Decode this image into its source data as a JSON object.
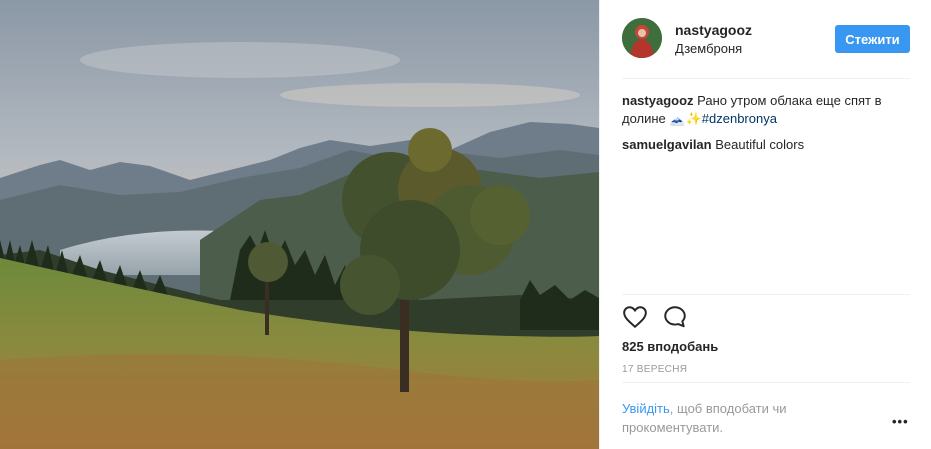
{
  "photo": {
    "description_icon": "landscape-photo"
  },
  "header": {
    "username": "nastyagooz",
    "location": "Дземброня",
    "follow_label": "Стежити"
  },
  "comments": [
    {
      "user": "nastyagooz",
      "text": "Рано утром облака еще спят в долине ",
      "emoji": "🗻✨",
      "hashtag": "#dzenbronya"
    },
    {
      "user": "samuelgavilan",
      "text": "Beautiful colors"
    }
  ],
  "actions": {
    "like_icon": "heart-icon",
    "comment_icon": "comment-icon"
  },
  "likes": "825 вподобань",
  "date": "17 ВЕРЕСНЯ",
  "login_prompt": {
    "link": "Увійдіть",
    "rest": ", щоб вподобати чи прокоментувати."
  },
  "more_label": "•••",
  "colors": {
    "accent": "#3897f0",
    "hashtag": "#003569",
    "muted": "#999999"
  }
}
